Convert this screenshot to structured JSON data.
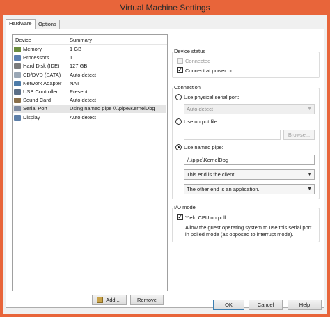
{
  "window": {
    "title": "Virtual Machine Settings",
    "title_bar_color": "#e8653a"
  },
  "tabs": [
    {
      "label": "Hardware",
      "active": true
    },
    {
      "label": "Options",
      "active": false
    }
  ],
  "device_list": {
    "columns": [
      "Device",
      "Summary"
    ],
    "rows": [
      {
        "device": "Memory",
        "summary": "1 GB",
        "icon": "memory-icon"
      },
      {
        "device": "Processors",
        "summary": "1",
        "icon": "processor-icon"
      },
      {
        "device": "Hard Disk (IDE)",
        "summary": "127 GB",
        "icon": "hard-disk-icon"
      },
      {
        "device": "CD/DVD (SATA)",
        "summary": "Auto detect",
        "icon": "cd-dvd-icon"
      },
      {
        "device": "Network Adapter",
        "summary": "NAT",
        "icon": "network-adapter-icon"
      },
      {
        "device": "USB Controller",
        "summary": "Present",
        "icon": "usb-controller-icon"
      },
      {
        "device": "Sound Card",
        "summary": "Auto detect",
        "icon": "sound-card-icon"
      },
      {
        "device": "Serial Port",
        "summary": "Using named pipe \\\\.\\pipe\\KernelDbg",
        "icon": "serial-port-icon",
        "selected": true
      },
      {
        "device": "Display",
        "summary": "Auto detect",
        "icon": "display-icon"
      }
    ],
    "add_label": "Add...",
    "remove_label": "Remove"
  },
  "device_status": {
    "title": "Device status",
    "connected_label": "Connected",
    "connected_checked": false,
    "connect_power_label": "Connect at power on",
    "connect_power_checked": true
  },
  "connection": {
    "title": "Connection",
    "physical_label": "Use physical serial port:",
    "physical_value": "Auto detect",
    "output_file_label": "Use output file:",
    "output_file_value": "",
    "browse_label": "Browse...",
    "named_pipe_label": "Use named pipe:",
    "named_pipe_value": "\\\\.\\pipe\\KernelDbg",
    "end_value": "This end is the client.",
    "other_end_value": "The other end is an application.",
    "selected": "named_pipe"
  },
  "io_mode": {
    "title": "I/O mode",
    "yield_label": "Yield CPU on poll",
    "yield_checked": true,
    "description": "Allow the guest operating system to use this serial port in polled mode (as opposed to interrupt mode)."
  },
  "footer": {
    "ok": "OK",
    "cancel": "Cancel",
    "help": "Help"
  }
}
